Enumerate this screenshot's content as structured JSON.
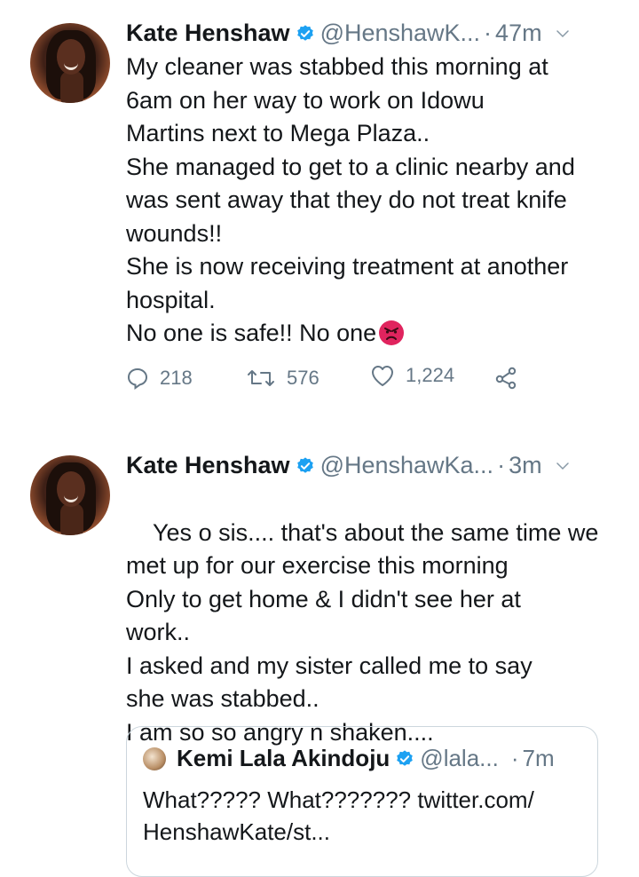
{
  "tweets": [
    {
      "name": "Kate Henshaw",
      "handle": "@HenshawK...",
      "separator": "·",
      "time": "47m",
      "text": "My cleaner was stabbed this morning at\n6am on her way to work on Idowu\nMartins next to Mega Plaza..\nShe managed to get to a clinic nearby and\nwas sent away that they do not treat knife\nwounds!!\nShe is now receiving treatment at another\nhospital.\nNo one is safe!! No one",
      "emoji": "angry-face-emoji",
      "replies": "218",
      "retweets": "576",
      "likes": "1,224"
    },
    {
      "name": "Kate Henshaw",
      "handle": "@HenshawKa...",
      "separator": "·",
      "time": "3m",
      "text": "Yes o sis.... that's about the same time we\nmet up for our exercise this morning\nOnly to get home & I didn't see her at\nwork..\nI asked and my sister called me to say\nshe was stabbed..\nI am so so angry n shaken....",
      "quote": {
        "name": "Kemi Lala Akindoju",
        "handle": "@lala...",
        "separator": "·",
        "time": "7m",
        "text": "What????? What??????? twitter.com/\nHenshawKate/st..."
      }
    }
  ],
  "colors": {
    "text": "#14171a",
    "secondary": "#657786",
    "verified": "#1da1f2",
    "border": "#ccd6dd"
  }
}
